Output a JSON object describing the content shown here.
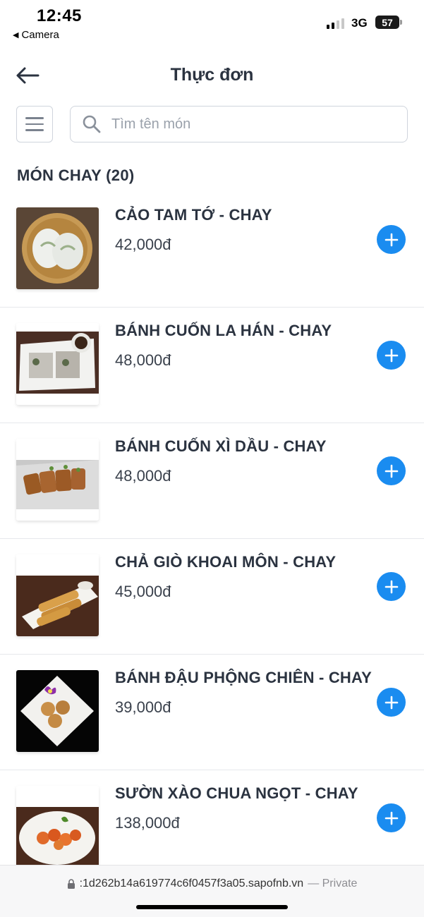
{
  "status_bar": {
    "time": "12:45",
    "back_app": "Camera",
    "network": "3G",
    "battery": "57"
  },
  "header": {
    "title": "Thực đơn"
  },
  "search": {
    "placeholder": "Tìm tên món",
    "value": ""
  },
  "section": {
    "title": "MÓN CHAY (20)"
  },
  "items": [
    {
      "name": "CẢO TAM TỚ - CHAY",
      "price": "42,000đ"
    },
    {
      "name": "BÁNH CUỐN LA HÁN - CHAY",
      "price": "48,000đ"
    },
    {
      "name": "BÁNH CUỐN XÌ DẦU - CHAY",
      "price": "48,000đ"
    },
    {
      "name": "CHẢ GIÒ KHOAI MÔN - CHAY",
      "price": "45,000đ"
    },
    {
      "name": "BÁNH ĐẬU PHỘNG CHIÊN - CHAY",
      "price": "39,000đ"
    },
    {
      "name": "SƯỜN XÀO CHUA NGỌT - CHAY",
      "price": "138,000đ"
    }
  ],
  "browser": {
    "url": ":1d262b14a619774c6f0457f3a05.sapofnb.vn",
    "private_label": "— Private"
  },
  "colors": {
    "accent": "#1a8cf0",
    "text": "#2b3340",
    "border": "#cfd4dc"
  }
}
